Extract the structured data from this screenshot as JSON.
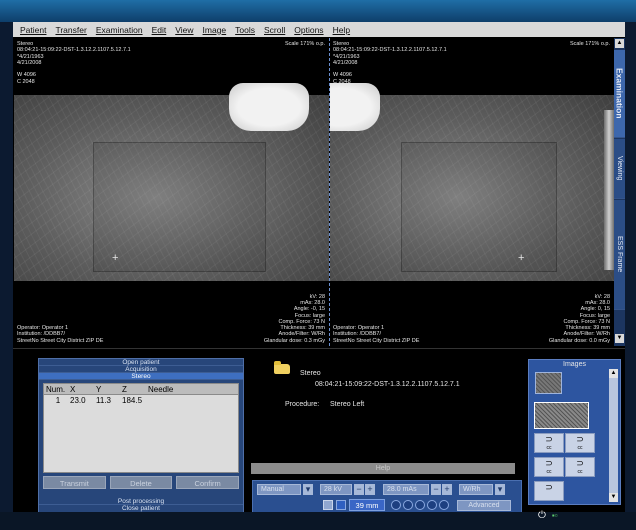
{
  "menu": [
    "Patient",
    "Transfer",
    "Examination",
    "Edit",
    "View",
    "Image",
    "Tools",
    "Scroll",
    "Options",
    "Help"
  ],
  "viewer": {
    "left": {
      "header_lines": [
        "Stereo",
        "08:04:21-15:09:22-DST-1.3.12.2.1107.5.12.7.1",
        "*4/21/1963",
        "4/21/2008",
        "",
        "W 4096",
        "C 2048"
      ],
      "scale": "Scale 171% o.p.",
      "footer_left": [
        "Operator: Operator 1",
        "Institution: /DDBB7/",
        "StreetNo  Street  City  District  ZIP  DE"
      ],
      "footer_right": [
        "kV: 28",
        "mAs: 28.0",
        "Angle: -0, 15",
        "Focus: large",
        "Comp. Force: 73 N",
        "Thickness: 39 mm",
        "Anode/Filter: W/Rh",
        "Glandular dose: 0.3 mGy"
      ]
    },
    "right": {
      "header_lines": [
        "Stereo",
        "08:04:21-15:09:22-DST-1.3.12.2.1107.5.12.7.1",
        "*4/21/1963",
        "4/21/2008",
        "",
        "W 4096",
        "C 2048"
      ],
      "scale": "Scale 171% o.p.",
      "footer_left": [
        "Operator: Operator 1",
        "Institution: /DDBB7/",
        "StreetNo  Street  City  District  ZIP  DE"
      ],
      "footer_right": [
        "kV: 28",
        "mAs: 28.0",
        "Angle: 0, 15",
        "Focus: large",
        "Comp. Force: 73 N",
        "Thickness: 39 mm",
        "Anode/Filter: W/Rh",
        "Glandular dose: 0.0 mGy"
      ]
    }
  },
  "side_tabs": [
    "Examination",
    "Viewing",
    "ESS Frame"
  ],
  "workflow": {
    "open_patient": "Open patient",
    "acquisition": "Acquisition",
    "stereo": "Stereo",
    "columns": [
      "Num.",
      "X",
      "Y",
      "Z",
      "Needle"
    ],
    "rows": [
      [
        "1",
        "23.0",
        "11.3",
        "184.5",
        ""
      ]
    ],
    "buttons": [
      "Transmit",
      "Delete",
      "Confirm"
    ],
    "post_processing": "Post processing",
    "close_patient": "Close patient"
  },
  "study": {
    "name": "Stereo",
    "id": "08:04:21-15:09:22-DST-1.3.12.2.1107.5.12.7.1",
    "procedure_label": "Procedure:",
    "procedure_value": "Stereo Left"
  },
  "help_label": "Help",
  "exposure": {
    "mode": "Manual",
    "kv": "28 kV",
    "mas": "28.0 mAs",
    "filter": "W/Rh",
    "thickness": "39 mm",
    "advanced": "Advanced"
  },
  "images_panel": {
    "title": "Images",
    "cells": [
      "cc",
      "cc",
      "cc",
      "cc"
    ]
  }
}
